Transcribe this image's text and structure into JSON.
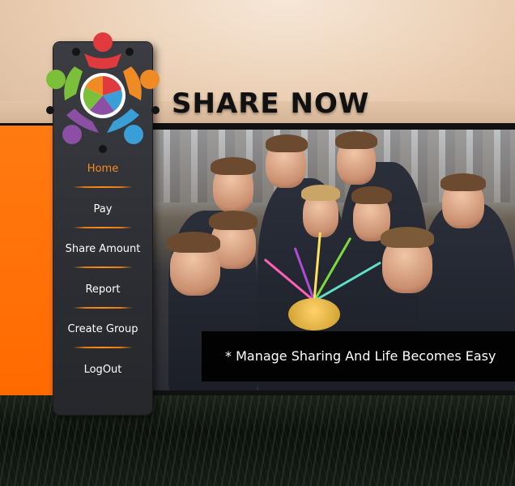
{
  "header": {
    "title": "SHARE NOW"
  },
  "logo": {
    "icon": "people-circle-pie-logo",
    "colors": [
      "#e0393e",
      "#f08a24",
      "#3a9fd6",
      "#8b4fa3",
      "#7cbf3b"
    ]
  },
  "sidebar": {
    "items": [
      {
        "label": "Home",
        "active": true
      },
      {
        "label": "Pay",
        "active": false
      },
      {
        "label": "Share Amount",
        "active": false
      },
      {
        "label": "Report",
        "active": false
      },
      {
        "label": "Create Group",
        "active": false
      },
      {
        "label": "LogOut",
        "active": false
      }
    ]
  },
  "hero": {
    "caption": "* Manage Sharing And Life Becomes Easy"
  },
  "colors": {
    "accent": "#ff6a00",
    "active_menu": "#ff8a1c",
    "panel": "#2f3136"
  }
}
